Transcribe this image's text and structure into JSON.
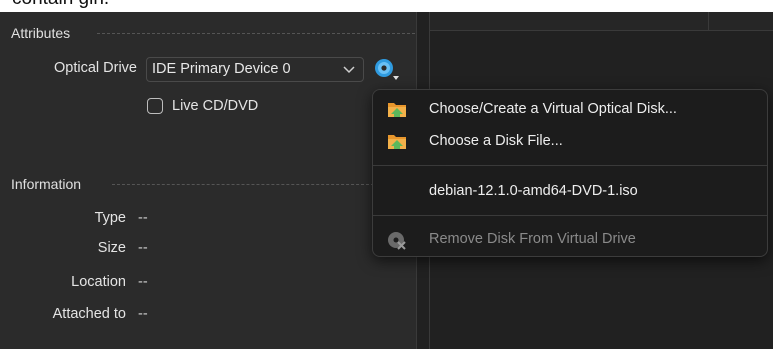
{
  "top_fragment": "contain gin.",
  "attributes": {
    "section_label": "Attributes",
    "optical_drive_label": "Optical Drive",
    "optical_drive_value": "IDE Primary Device 0",
    "live_cd_label": "Live CD/DVD",
    "live_cd_checked": false
  },
  "information": {
    "section_label": "Information",
    "fields": [
      {
        "label": "Type",
        "value": "--"
      },
      {
        "label": "Size",
        "value": "--"
      },
      {
        "label": "Location",
        "value": "--"
      },
      {
        "label": "Attached to",
        "value": "--"
      }
    ]
  },
  "disk_menu": {
    "items": [
      {
        "label": "Choose/Create a Virtual Optical Disk...",
        "icon": "folder-arrow-icon",
        "enabled": true
      },
      {
        "label": "Choose a Disk File...",
        "icon": "folder-arrow-icon",
        "enabled": true
      },
      {
        "label": "debian-12.1.0-amd64-DVD-1.iso",
        "icon": "",
        "enabled": true
      },
      {
        "label": "Remove Disk From Virtual Drive",
        "icon": "remove-disk-icon",
        "enabled": false
      }
    ]
  },
  "colors": {
    "panel_bg": "#2b2b2b",
    "menu_bg": "#1c1c1c",
    "folder_orange": "#e8962c",
    "folder_green": "#5cb85c",
    "disc_blue": "#2f9be0"
  }
}
